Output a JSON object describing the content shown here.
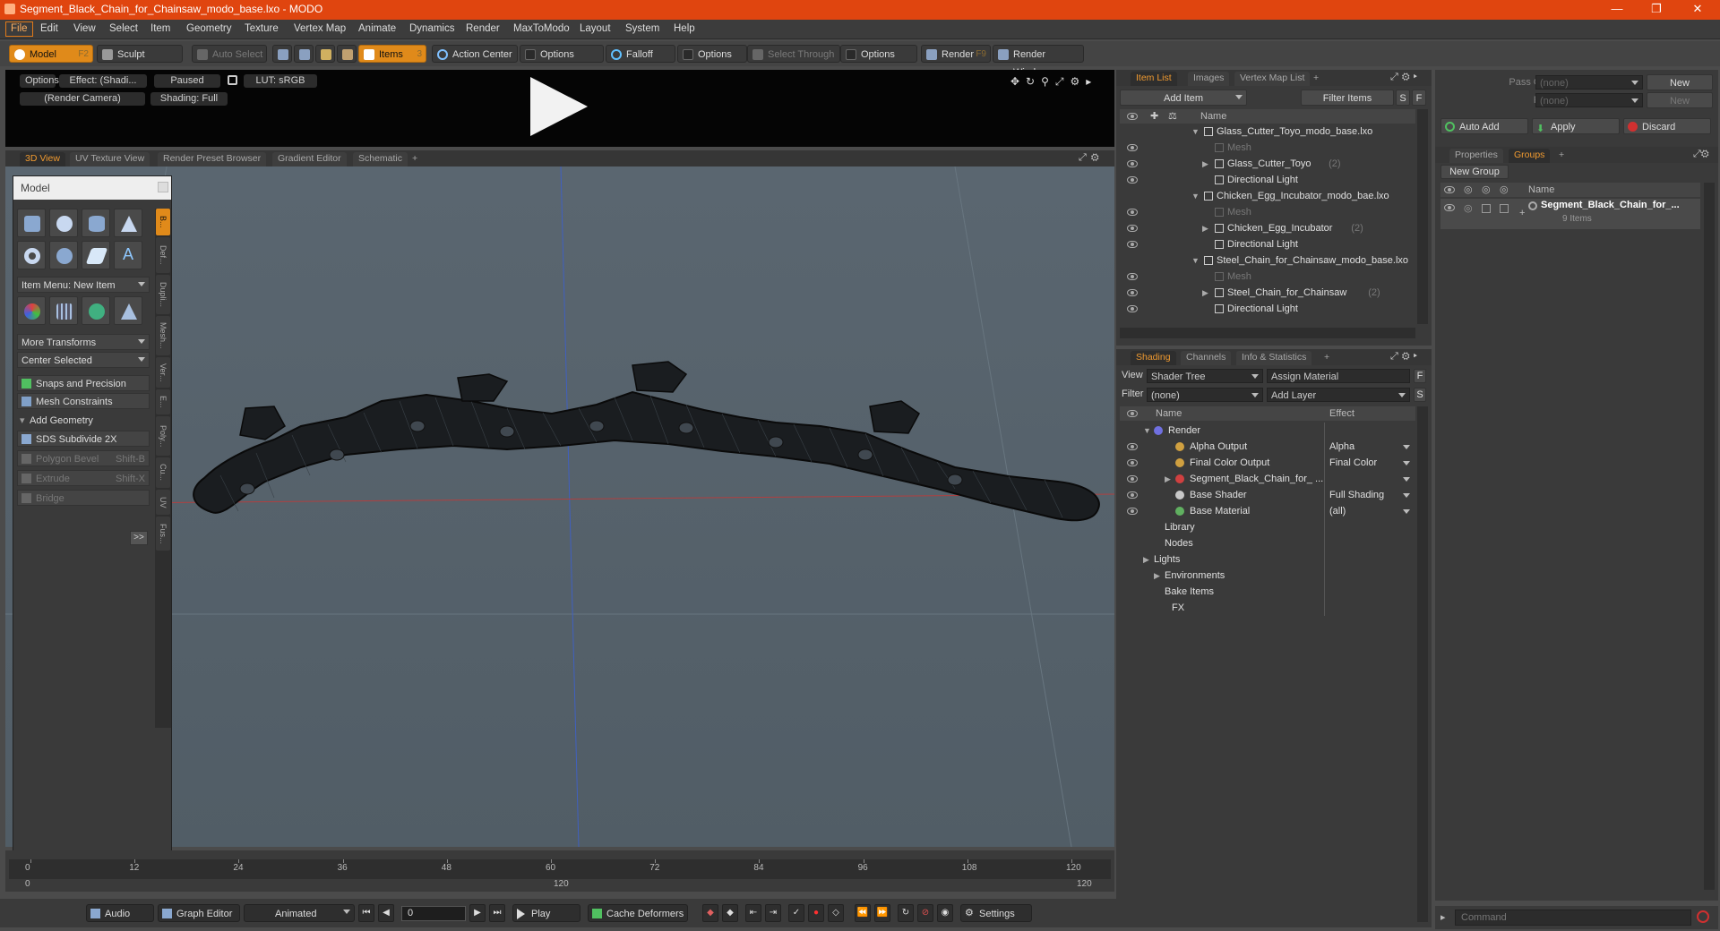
{
  "window": {
    "title": "Segment_Black_Chain_for_Chainsaw_modo_base.lxo - MODO"
  },
  "menu": [
    "File",
    "Edit",
    "View",
    "Select",
    "Item",
    "Geometry",
    "Texture",
    "Vertex Map",
    "Animate",
    "Dynamics",
    "Render",
    "MaxToModo",
    "Layout",
    "System",
    "Help"
  ],
  "toolbar": {
    "model": "Model",
    "model_key": "F2",
    "sculpt": "Sculpt",
    "auto_select": "Auto Select",
    "items": "Items",
    "items_key": "3",
    "action_center": "Action Center",
    "options1": "Options",
    "falloff": "Falloff",
    "options2": "Options",
    "select_through": "Select Through",
    "options3": "Options",
    "render": "Render",
    "render_key": "F9",
    "render_window": "Render Window"
  },
  "render_preview": {
    "options": "Options",
    "effect": "Effect: (Shadi...",
    "paused": "Paused",
    "lut": "LUT: sRGB",
    "camera": "(Render Camera)",
    "shading": "Shading: Full"
  },
  "viewport_tabs": [
    "3D View",
    "UV Texture View",
    "Render Preset Browser",
    "Gradient Editor",
    "Schematic",
    "+"
  ],
  "toolbox": {
    "title": "Model",
    "item_menu": "Item Menu: New Item",
    "more_transforms": "More Transforms",
    "center_selected": "Center Selected",
    "snaps": "Snaps and Precision",
    "mesh_constraints": "Mesh Constraints",
    "add_geometry": "Add Geometry",
    "sds": "SDS Subdivide 2X",
    "polygon_bevel": "Polygon Bevel",
    "polygon_bevel_key": "Shift-B",
    "extrude": "Extrude",
    "extrude_key": "Shift-X",
    "bridge": "Bridge",
    "more": ">>",
    "vtabs": [
      "B...",
      "Def...",
      "Dupli...",
      "Mesh...",
      "Ver...",
      "E...",
      "Poly...",
      "Cu...",
      "UV",
      "Fus..."
    ]
  },
  "timeline": {
    "ticks": [
      "0",
      "12",
      "24",
      "36",
      "48",
      "60",
      "72",
      "84",
      "96",
      "108",
      "120"
    ],
    "bottom_left": "0",
    "bottom_mid": "120",
    "bottom_right": "120"
  },
  "transport": {
    "audio": "Audio",
    "graph_editor": "Graph Editor",
    "animated": "Animated",
    "frame": "0",
    "play": "Play",
    "cache_deformers": "Cache Deformers",
    "settings": "Settings"
  },
  "item_list": {
    "tabs": [
      "Item List",
      "Images",
      "Vertex Map List",
      "+"
    ],
    "add_item": "Add Item",
    "filter_items": "Filter Items",
    "s_btn": "S",
    "f_btn": "F",
    "col_name": "Name",
    "rows": [
      {
        "label": "Glass_Cutter_Toyo_modo_base.lxo",
        "indent": 0,
        "dim": false,
        "count": ""
      },
      {
        "label": "Mesh",
        "indent": 1,
        "dim": true,
        "count": ""
      },
      {
        "label": "Glass_Cutter_Toyo",
        "indent": 1,
        "dim": false,
        "count": "(2)"
      },
      {
        "label": "Directional Light",
        "indent": 1,
        "dim": false,
        "count": ""
      },
      {
        "label": "Chicken_Egg_Incubator_modo_bae.lxo",
        "indent": 0,
        "dim": false,
        "count": ""
      },
      {
        "label": "Mesh",
        "indent": 1,
        "dim": true,
        "count": ""
      },
      {
        "label": "Chicken_Egg_Incubator",
        "indent": 1,
        "dim": false,
        "count": "(2)"
      },
      {
        "label": "Directional Light",
        "indent": 1,
        "dim": false,
        "count": ""
      },
      {
        "label": "Steel_Chain_for_Chainsaw_modo_base.lxo",
        "indent": 0,
        "dim": false,
        "count": ""
      },
      {
        "label": "Mesh",
        "indent": 1,
        "dim": true,
        "count": ""
      },
      {
        "label": "Steel_Chain_for_Chainsaw",
        "indent": 1,
        "dim": false,
        "count": "(2)"
      },
      {
        "label": "Directional Light",
        "indent": 1,
        "dim": false,
        "count": ""
      }
    ]
  },
  "shading": {
    "tabs": [
      "Shading",
      "Channels",
      "Info & Statistics",
      "+"
    ],
    "view_label": "View",
    "view_value": "Shader Tree",
    "assign_material": "Assign Material",
    "f_btn": "F",
    "filter_label": "Filter",
    "filter_value": "(none)",
    "add_layer": "Add Layer",
    "s_btn": "S",
    "col_name": "Name",
    "col_effect": "Effect",
    "rows": [
      {
        "label": "Render",
        "effect": "",
        "indent": 0,
        "color": "#7070e0"
      },
      {
        "label": "Alpha Output",
        "effect": "Alpha",
        "indent": 1,
        "color": "#d0a040"
      },
      {
        "label": "Final Color Output",
        "effect": "Final Color",
        "indent": 1,
        "color": "#d0a040"
      },
      {
        "label": "Segment_Black_Chain_for_ ...",
        "effect": "",
        "indent": 1,
        "color": "#d04040"
      },
      {
        "label": "Base Shader",
        "effect": "Full Shading",
        "indent": 1,
        "color": "#c8c8c8"
      },
      {
        "label": "Base Material",
        "effect": "(all)",
        "indent": 1,
        "color": "#60b060"
      },
      {
        "label": "Library",
        "effect": "",
        "indent": 2,
        "color": ""
      },
      {
        "label": "Nodes",
        "effect": "",
        "indent": 2,
        "color": ""
      },
      {
        "label": "Lights",
        "effect": "",
        "indent": 3,
        "color": ""
      },
      {
        "label": "Environments",
        "effect": "",
        "indent": 3,
        "color": ""
      },
      {
        "label": "Bake Items",
        "effect": "",
        "indent": 2,
        "color": ""
      },
      {
        "label": "FX",
        "effect": "",
        "indent": 4,
        "color": ""
      }
    ]
  },
  "groups_panel": {
    "pass_groups": "Pass Groups",
    "pass_groups_value": "(none)",
    "new1": "New",
    "passes": "Passes",
    "passes_value": "(none)",
    "new2": "New",
    "auto_add": "Auto Add",
    "apply": "Apply",
    "discard": "Discard",
    "tabs": [
      "Properties",
      "Groups",
      "+"
    ],
    "new_group": "New Group",
    "col_name": "Name",
    "group_name": "Segment_Black_Chain_for_...",
    "group_items": "9 Items"
  },
  "command": {
    "placeholder": "Command"
  }
}
